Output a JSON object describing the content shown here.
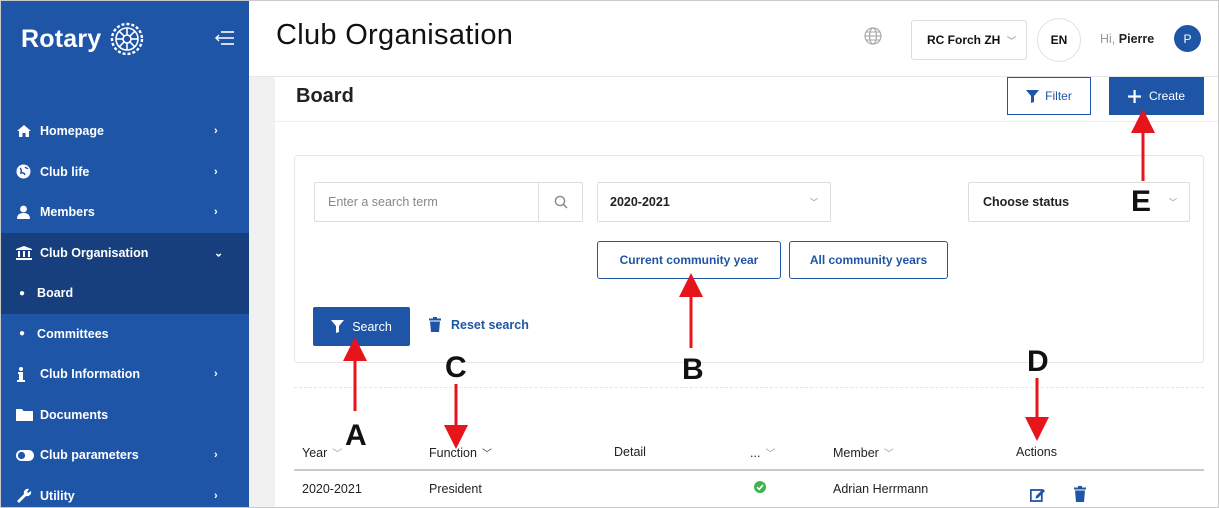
{
  "sidebar": {
    "logo_text": "Rotary",
    "items": [
      {
        "label": "Homepage",
        "icon": "home-icon"
      },
      {
        "label": "Club life",
        "icon": "globe-icon"
      },
      {
        "label": "Members",
        "icon": "user-icon"
      },
      {
        "label": "Club Organisation",
        "icon": "institution-icon",
        "expanded": true
      },
      {
        "label": "Board",
        "sub": true,
        "active": true
      },
      {
        "label": "Committees",
        "sub": true
      },
      {
        "label": "Club Information",
        "icon": "info-icon"
      },
      {
        "label": "Documents",
        "icon": "folder-icon"
      },
      {
        "label": "Club parameters",
        "icon": "toggle-icon"
      },
      {
        "label": "Utility",
        "icon": "wrench-icon"
      }
    ]
  },
  "header": {
    "title": "Club Organisation",
    "club_select": "RC Forch ZH",
    "language": "EN",
    "greeting_prefix": "Hi,",
    "user_name": "Pierre",
    "avatar_initial": "P"
  },
  "main": {
    "section_title": "Board",
    "filter_label": "Filter",
    "create_label": "Create",
    "search_placeholder": "Enter a search term",
    "year_select": "2020-2021",
    "status_placeholder": "Choose status",
    "current_year_btn": "Current community year",
    "all_years_btn": "All community years",
    "search_btn": "Search",
    "reset_link": "Reset search"
  },
  "table": {
    "headers": [
      "Year",
      "Function",
      "Detail",
      "...",
      "Member",
      "Actions"
    ],
    "rows": [
      {
        "year": "2020-2021",
        "function": "President",
        "detail": "",
        "status": "active",
        "member": "Adrian Herrmann"
      }
    ]
  },
  "annotations": {
    "a": "A",
    "b": "B",
    "c": "C",
    "d": "D",
    "e": "E"
  },
  "colors": {
    "brand": "#1f55a6",
    "sidebar_active": "#173f7d",
    "check": "#3fb34f",
    "annotation_arrow": "#e8141c"
  }
}
